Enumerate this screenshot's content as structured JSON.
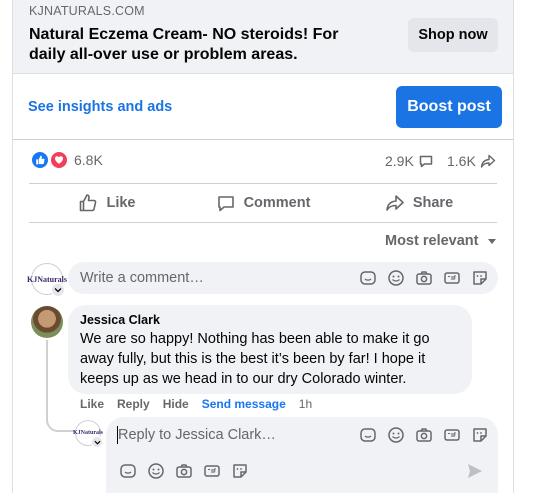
{
  "ad": {
    "domain": "KJNATURALS.COM",
    "headline": "Natural Eczema Cream- NO steroids! For daily all-over use or problem areas.",
    "cta_label": "Shop now"
  },
  "insights": {
    "link_label": "See insights and ads",
    "boost_label": "Boost post"
  },
  "reactions": {
    "total": "6.8K",
    "comments": "2.9K",
    "shares": "1.6K"
  },
  "actions": {
    "like": "Like",
    "comment": "Comment",
    "share": "Share"
  },
  "sort": {
    "label": "Most relevant"
  },
  "composer": {
    "placeholder": "Write a comment…"
  },
  "comment": {
    "author": "Jessica Clark",
    "text": "We are so happy! Nothing has been able to make it go away fully, but this is the best it’s been by far! I hope it keeps up as we head in to our dry Colorado winter.",
    "like": "Like",
    "reply": "Reply",
    "hide": "Hide",
    "send_message": "Send message",
    "time": "1h"
  },
  "reply": {
    "placeholder": "Reply to Jessica Clark…"
  },
  "avatar_text": "KJNaturals",
  "colors": {
    "accent": "#1b74e4",
    "like_blue": "#1877f2",
    "love_red": "#f33e58",
    "secondary_text": "#65676b",
    "bubble_bg": "#f0f2f5"
  }
}
